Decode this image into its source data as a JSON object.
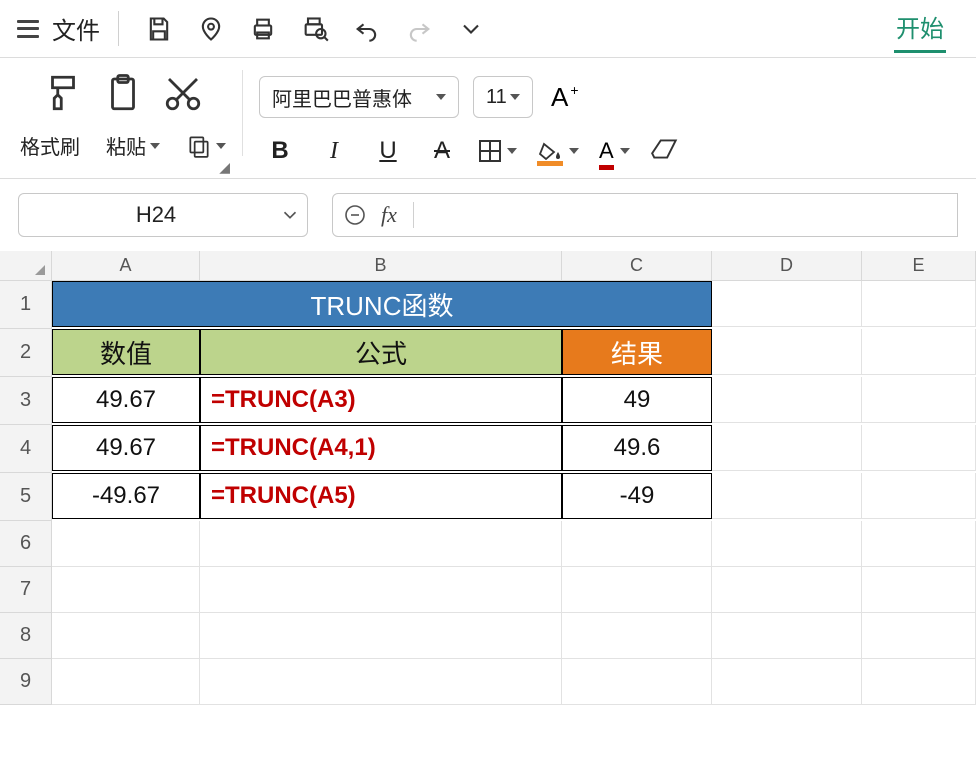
{
  "menubar": {
    "file_label": "文件",
    "start_tab": "开始"
  },
  "ribbon": {
    "format_painter_label": "格式刷",
    "paste_label": "粘贴",
    "font_name": "阿里巴巴普惠体",
    "font_size": "11",
    "increase_font": "A",
    "bold": "B",
    "italic": "I",
    "underline": "U",
    "strike": "A",
    "font_color_letter": "A",
    "fill_color": "#f08c28",
    "font_color": "#c00000"
  },
  "namebox": {
    "value": "H24"
  },
  "formula_bar": {
    "fx": "fx",
    "value": ""
  },
  "columns": [
    "A",
    "B",
    "C",
    "D",
    "E"
  ],
  "rows": [
    "1",
    "2",
    "3",
    "4",
    "5",
    "6",
    "7",
    "8",
    "9"
  ],
  "table": {
    "title": "TRUNC函数",
    "headers": {
      "value": "数值",
      "formula": "公式",
      "result": "结果"
    },
    "data": [
      {
        "value": "49.67",
        "formula": "=TRUNC(A3)",
        "result": "49"
      },
      {
        "value": "49.67",
        "formula": "=TRUNC(A4,1)",
        "result": "49.6"
      },
      {
        "value": "-49.67",
        "formula": "=TRUNC(A5)",
        "result": "-49"
      }
    ]
  },
  "chart_data": {
    "type": "table",
    "title": "TRUNC函数",
    "columns": [
      "数值",
      "公式",
      "结果"
    ],
    "rows": [
      [
        "49.67",
        "=TRUNC(A3)",
        "49"
      ],
      [
        "49.67",
        "=TRUNC(A4,1)",
        "49.6"
      ],
      [
        "-49.67",
        "=TRUNC(A5)",
        "-49"
      ]
    ]
  }
}
